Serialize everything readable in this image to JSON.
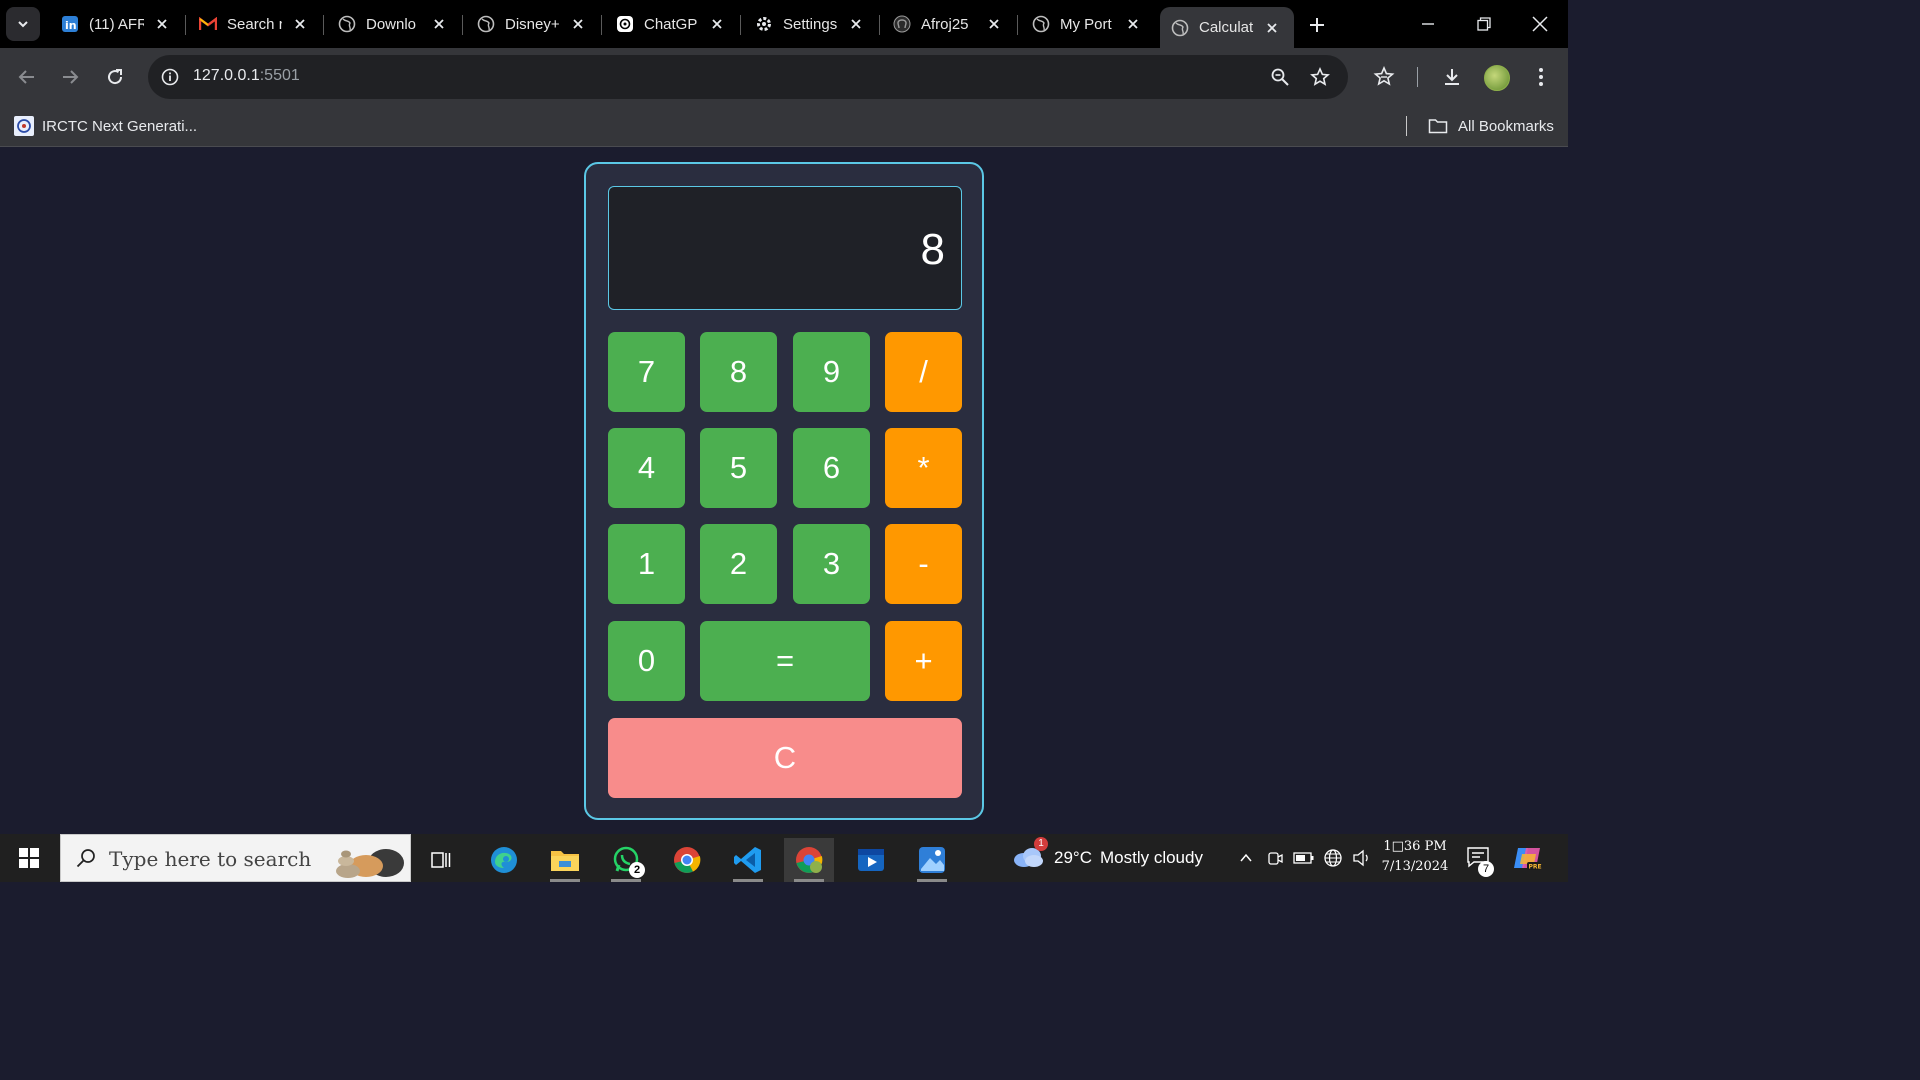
{
  "browser": {
    "tabs": [
      {
        "title": "(11) AFR",
        "icon": "linkedin-icon"
      },
      {
        "title": "Search r",
        "icon": "gmail-icon"
      },
      {
        "title": "Downlo",
        "icon": "globe-icon"
      },
      {
        "title": "Disney+",
        "icon": "globe-icon"
      },
      {
        "title": "ChatGP",
        "icon": "chatgpt-icon"
      },
      {
        "title": "Settings",
        "icon": "gear-icon"
      },
      {
        "title": "Afroj25",
        "icon": "github-icon"
      },
      {
        "title": "My Port",
        "icon": "globe-icon"
      },
      {
        "title": "Calculat",
        "icon": "globe-icon",
        "active": true
      }
    ],
    "address": {
      "host": "127.0.0.1",
      "port": ":5501"
    },
    "bookmarks": {
      "item": "IRCTC Next Generati...",
      "all": "All Bookmarks"
    }
  },
  "calculator": {
    "display": "8",
    "keys": {
      "k7": "7",
      "k8": "8",
      "k9": "9",
      "kdiv": "/",
      "k4": "4",
      "k5": "5",
      "k6": "6",
      "kmul": "*",
      "k1": "1",
      "k2": "2",
      "k3": "3",
      "ksub": "-",
      "k0": "0",
      "keq": "=",
      "kadd": "+",
      "kclr": "C"
    },
    "colors": {
      "number": "#4caf50",
      "operator": "#ff9800",
      "clear": "#f88c8b",
      "border": "#5bc8e6"
    }
  },
  "taskbar": {
    "search_placeholder": "Type here to search",
    "whatsapp_badge": "2",
    "weather": {
      "temp": "29°C",
      "condition": "Mostly cloudy",
      "badge": "1"
    },
    "clock": {
      "time": "1□36 PM",
      "date": "7/13/2024"
    },
    "notification_count": "7"
  }
}
